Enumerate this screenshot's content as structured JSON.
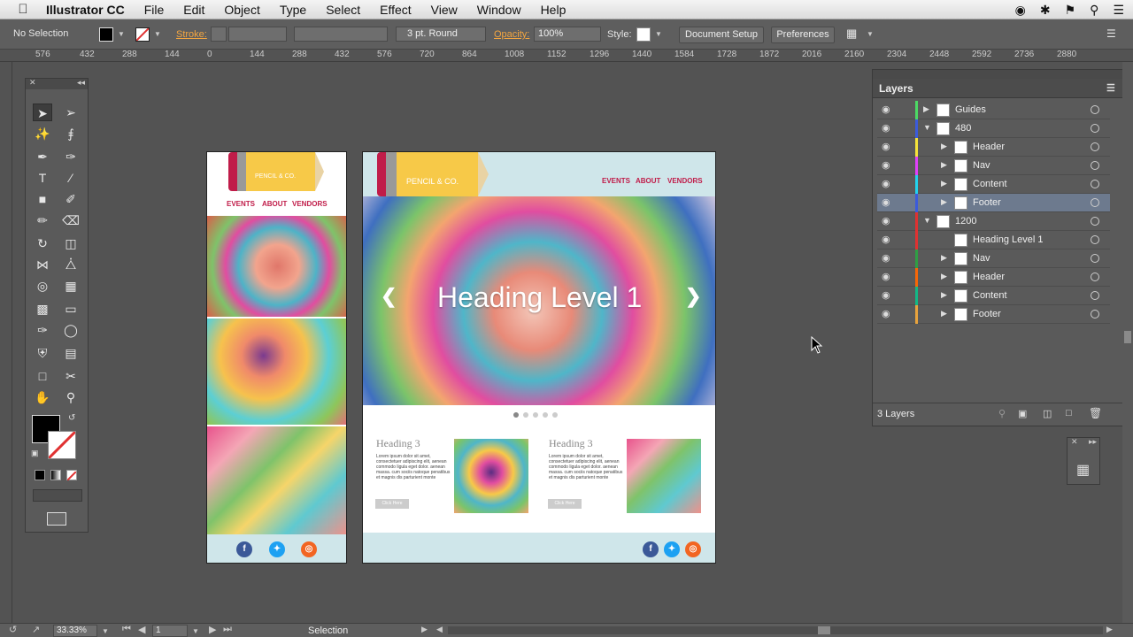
{
  "menubar": {
    "app_name": "Illustrator CC",
    "items": [
      "File",
      "Edit",
      "Object",
      "Type",
      "Select",
      "Effect",
      "View",
      "Window",
      "Help"
    ]
  },
  "control_bar": {
    "selection": "No Selection",
    "stroke_label": "Stroke:",
    "brush_value": "3 pt. Round",
    "opacity_label": "Opacity:",
    "opacity_value": "100%",
    "style_label": "Style:",
    "document_setup": "Document Setup",
    "preferences": "Preferences"
  },
  "ruler_top": [
    "576",
    "432",
    "288",
    "144",
    "0",
    "144",
    "288",
    "432",
    "576",
    "720",
    "864",
    "1008",
    "1152",
    "1296",
    "1440",
    "1584",
    "1728",
    "1872",
    "2016",
    "2160",
    "2304",
    "2448",
    "2592",
    "2736",
    "2880"
  ],
  "artboard_small": {
    "logo": "PENCIL & CO.",
    "nav": [
      "EVENTS",
      "ABOUT",
      "VENDORS"
    ]
  },
  "artboard_large": {
    "logo": "PENCIL & CO.",
    "nav": [
      "EVENTS",
      "ABOUT",
      "VENDORS"
    ],
    "hero_heading": "Heading Level 1",
    "cards": [
      {
        "heading": "Heading 3",
        "body": "Lorem ipsum dolor sit amet, consectetuer adipiscing elit, aenean commodo ligula eget dolor. aenean massa. cum sociis natoque penatibus et magnis dis parturient monte",
        "button": "Click Here"
      },
      {
        "heading": "Heading 3",
        "body": "Lorem ipsum dolor sit amet, consectetuer adipiscing elit, aenean commodo ligula eget dolor. aenean massa. cum sociis natoque penatibus et magnis dis parturient monte",
        "button": "Click Here"
      }
    ]
  },
  "layers_panel": {
    "title": "Layers",
    "count": "3 Layers",
    "rows": [
      {
        "name": "Guides",
        "color": "#4cd964",
        "expanded": false,
        "level": 0,
        "selected": false
      },
      {
        "name": "480",
        "color": "#3b5bdb",
        "expanded": true,
        "level": 0,
        "selected": false
      },
      {
        "name": "Header",
        "color": "#f5e33a",
        "expanded": false,
        "level": 1,
        "selected": false
      },
      {
        "name": "Nav",
        "color": "#e040fb",
        "expanded": false,
        "level": 1,
        "selected": false
      },
      {
        "name": "Content",
        "color": "#22d3ee",
        "expanded": false,
        "level": 1,
        "selected": false
      },
      {
        "name": "Footer",
        "color": "#3b5bdb",
        "expanded": false,
        "level": 1,
        "selected": true
      },
      {
        "name": "1200",
        "color": "#e03131",
        "expanded": true,
        "level": 0,
        "selected": false
      },
      {
        "name": "Heading Level 1",
        "color": "#e03131",
        "expanded": null,
        "level": 1,
        "selected": false
      },
      {
        "name": "Nav",
        "color": "#2f9e44",
        "expanded": false,
        "level": 1,
        "selected": false
      },
      {
        "name": "Header",
        "color": "#f76707",
        "expanded": false,
        "level": 1,
        "selected": false
      },
      {
        "name": "Content",
        "color": "#12b886",
        "expanded": false,
        "level": 1,
        "selected": false
      },
      {
        "name": "Footer",
        "color": "#e8a33d",
        "expanded": false,
        "level": 1,
        "selected": false
      }
    ]
  },
  "status_bar": {
    "zoom": "33.33%",
    "page": "1",
    "mode": "Selection"
  },
  "colors": {
    "brand_red": "#c01c49",
    "logo_yellow": "#f7c948",
    "footer_bg": "#cfe6ea",
    "facebook": "#3b5998",
    "twitter": "#1da1f2",
    "rss": "#f26522"
  }
}
